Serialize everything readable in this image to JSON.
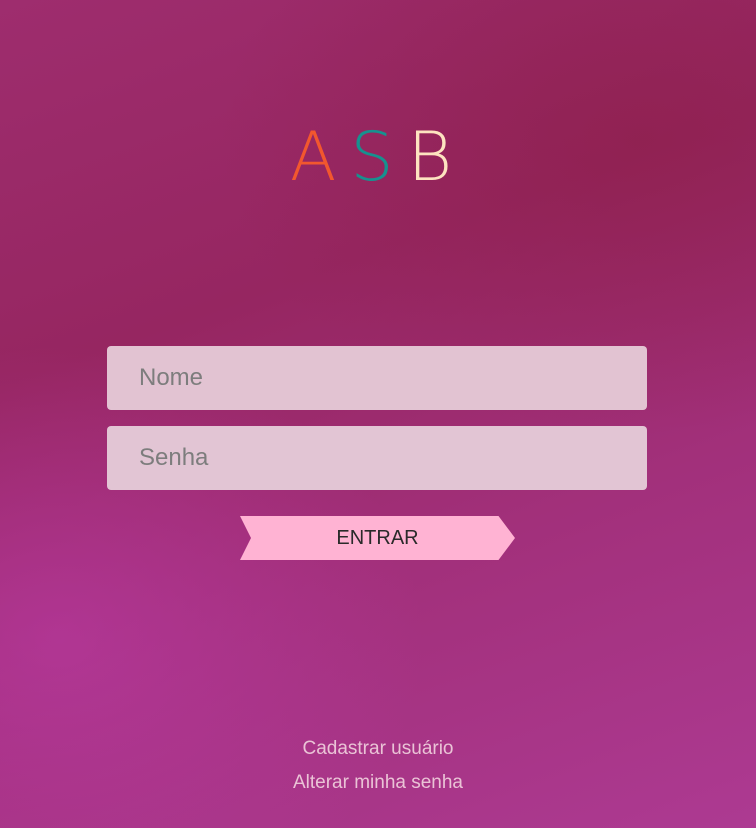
{
  "logo": {
    "letters": [
      {
        "char": "A",
        "color": "#f2572e"
      },
      {
        "char": "S",
        "color": "#17918f"
      },
      {
        "char": "B",
        "color": "#fde3c0"
      }
    ]
  },
  "form": {
    "nome_placeholder": "Nome",
    "nome_value": "",
    "senha_placeholder": "Senha",
    "senha_value": "",
    "submit_label": "ENTRAR"
  },
  "links": {
    "cadastrar": "Cadastrar usuário",
    "alterar_senha": "Alterar minha senha"
  },
  "colors": {
    "submit_background": "#ffb3d3",
    "field_background": "#e2c3d2",
    "link_color": "#eac3d6"
  }
}
